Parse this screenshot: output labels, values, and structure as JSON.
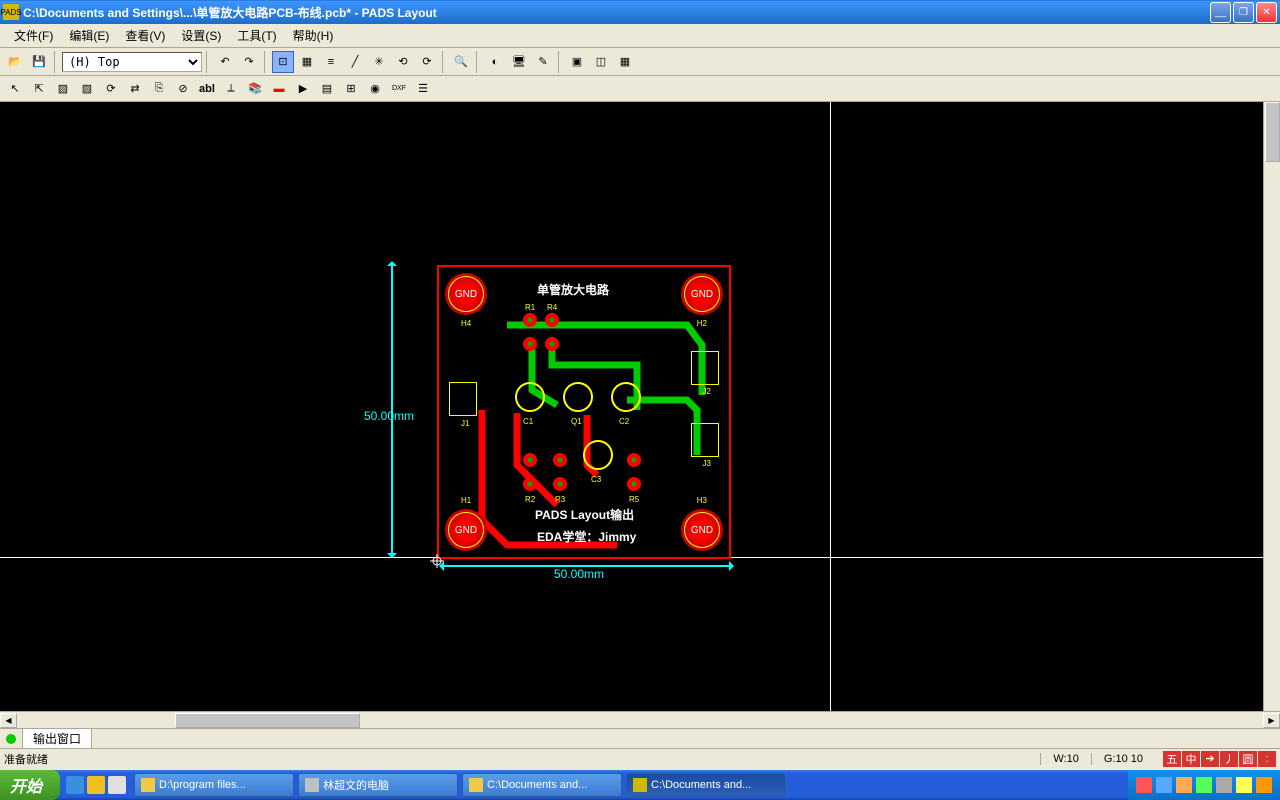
{
  "window": {
    "title": "C:\\Documents and Settings\\...\\单管放大电路PCB-布线.pcb* - PADS Layout",
    "app_icon_text": "PADS"
  },
  "menu": {
    "file": "文件(F)",
    "edit": "编辑(E)",
    "view": "查看(V)",
    "setup": "设置(S)",
    "tools": "工具(T)",
    "help": "帮助(H)"
  },
  "toolbar": {
    "layer_selected": "(H) Top"
  },
  "canvas": {
    "board_title": "单管放大电路",
    "board_subtitle1": "PADS Layout输出",
    "board_subtitle2": "EDA学堂：Jimmy",
    "dim_v": "50.00mm",
    "dim_h": "50.00mm",
    "gnd_label": "GND",
    "refs": {
      "H1": "H1",
      "H2": "H2",
      "H3": "H3",
      "H4": "H4",
      "R1": "R1",
      "R2": "R2",
      "R3": "R3",
      "R4": "R4",
      "R5": "R5",
      "C1": "C1",
      "C2": "C2",
      "C3": "C3",
      "Q1": "Q1",
      "J1": "J1",
      "J2": "J2",
      "J3": "J3"
    }
  },
  "output_window": {
    "tab": "输出窗口"
  },
  "statusbar": {
    "msg": "准备就绪",
    "w": "W:10",
    "g": "G:10 10",
    "ime": [
      "五",
      "中",
      "➔",
      "丿",
      "圆",
      ":"
    ]
  },
  "taskbar": {
    "start": "开始",
    "buttons": [
      "D:\\program files...",
      "林超文的电脑",
      "C:\\Documents and...",
      "C:\\Documents and..."
    ]
  }
}
